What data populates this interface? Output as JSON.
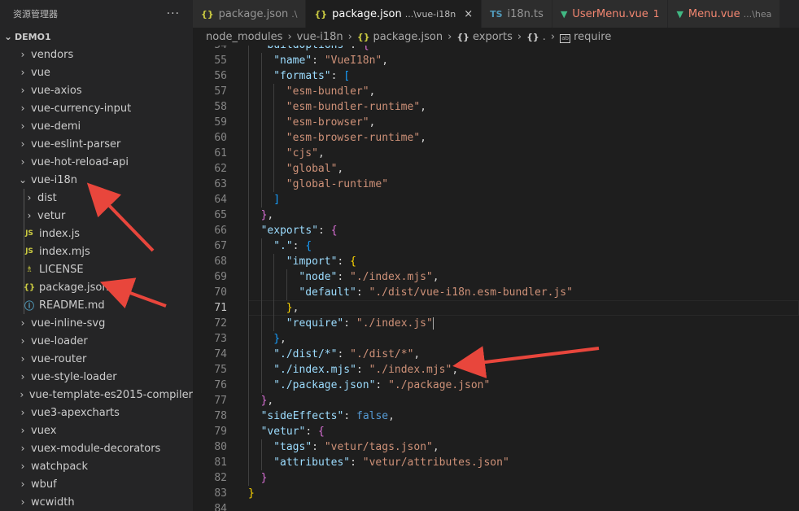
{
  "sidebar": {
    "title": "资源管理器",
    "more": "···",
    "project": "DEMO1",
    "items": [
      {
        "label": "vendors",
        "type": "folder",
        "depth": 1,
        "expanded": false
      },
      {
        "label": "vue",
        "type": "folder",
        "depth": 1,
        "expanded": false
      },
      {
        "label": "vue-axios",
        "type": "folder",
        "depth": 1,
        "expanded": false
      },
      {
        "label": "vue-currency-input",
        "type": "folder",
        "depth": 1,
        "expanded": false
      },
      {
        "label": "vue-demi",
        "type": "folder",
        "depth": 1,
        "expanded": false
      },
      {
        "label": "vue-eslint-parser",
        "type": "folder",
        "depth": 1,
        "expanded": false
      },
      {
        "label": "vue-hot-reload-api",
        "type": "folder",
        "depth": 1,
        "expanded": false
      },
      {
        "label": "vue-i18n",
        "type": "folder",
        "depth": 1,
        "expanded": true
      },
      {
        "label": "dist",
        "type": "folder",
        "depth": 2,
        "expanded": false
      },
      {
        "label": "vetur",
        "type": "folder",
        "depth": 2,
        "expanded": false
      },
      {
        "label": "index.js",
        "type": "js",
        "depth": 2
      },
      {
        "label": "index.mjs",
        "type": "js",
        "depth": 2
      },
      {
        "label": "LICENSE",
        "type": "license",
        "depth": 2
      },
      {
        "label": "package.json",
        "type": "json",
        "depth": 2
      },
      {
        "label": "README.md",
        "type": "info",
        "depth": 2
      },
      {
        "label": "vue-inline-svg",
        "type": "folder",
        "depth": 1,
        "expanded": false
      },
      {
        "label": "vue-loader",
        "type": "folder",
        "depth": 1,
        "expanded": false
      },
      {
        "label": "vue-router",
        "type": "folder",
        "depth": 1,
        "expanded": false
      },
      {
        "label": "vue-style-loader",
        "type": "folder",
        "depth": 1,
        "expanded": false
      },
      {
        "label": "vue-template-es2015-compiler",
        "type": "folder",
        "depth": 1,
        "expanded": false
      },
      {
        "label": "vue3-apexcharts",
        "type": "folder",
        "depth": 1,
        "expanded": false
      },
      {
        "label": "vuex",
        "type": "folder",
        "depth": 1,
        "expanded": false
      },
      {
        "label": "vuex-module-decorators",
        "type": "folder",
        "depth": 1,
        "expanded": false
      },
      {
        "label": "watchpack",
        "type": "folder",
        "depth": 1,
        "expanded": false
      },
      {
        "label": "wbuf",
        "type": "folder",
        "depth": 1,
        "expanded": false
      },
      {
        "label": "wcwidth",
        "type": "folder",
        "depth": 1,
        "expanded": false
      }
    ]
  },
  "tabs": [
    {
      "icon": "{}",
      "icon_type": "json",
      "label": "package.json",
      "desc": ".\\",
      "active": false
    },
    {
      "icon": "{}",
      "icon_type": "json",
      "label": "package.json",
      "desc": "...\\vue-i18n",
      "active": true,
      "close": "×"
    },
    {
      "icon": "TS",
      "icon_type": "ts",
      "label": "i18n.ts",
      "desc": "",
      "active": false
    },
    {
      "icon": "V",
      "icon_type": "vue",
      "label": "UserMenu.vue",
      "desc": "",
      "active": false,
      "error": true,
      "error_count": "1"
    },
    {
      "icon": "V",
      "icon_type": "vue",
      "label": "Menu.vue",
      "desc": "...\\hea",
      "active": false,
      "error": true
    }
  ],
  "breadcrumb": {
    "parts": [
      "node_modules",
      "vue-i18n",
      "package.json",
      "exports",
      ".",
      "require"
    ],
    "icons": [
      "",
      "",
      "{}",
      "{}",
      "{}",
      "abc"
    ]
  },
  "editor": {
    "current_line": 71,
    "lines": [
      {
        "n": "54",
        "indent": 1,
        "tokens": [
          [
            "k",
            "\"buildOptions\""
          ],
          [
            "p",
            ": "
          ],
          [
            "b2",
            "{"
          ]
        ]
      },
      {
        "n": "55",
        "indent": 2,
        "tokens": [
          [
            "k",
            "\"name\""
          ],
          [
            "p",
            ": "
          ],
          [
            "s",
            "\"VueI18n\""
          ],
          [
            "p",
            ","
          ]
        ]
      },
      {
        "n": "56",
        "indent": 2,
        "tokens": [
          [
            "k",
            "\"formats\""
          ],
          [
            "p",
            ": "
          ],
          [
            "b3",
            "["
          ]
        ]
      },
      {
        "n": "57",
        "indent": 3,
        "tokens": [
          [
            "s",
            "\"esm-bundler\""
          ],
          [
            "p",
            ","
          ]
        ]
      },
      {
        "n": "58",
        "indent": 3,
        "tokens": [
          [
            "s",
            "\"esm-bundler-runtime\""
          ],
          [
            "p",
            ","
          ]
        ]
      },
      {
        "n": "59",
        "indent": 3,
        "tokens": [
          [
            "s",
            "\"esm-browser\""
          ],
          [
            "p",
            ","
          ]
        ]
      },
      {
        "n": "60",
        "indent": 3,
        "tokens": [
          [
            "s",
            "\"esm-browser-runtime\""
          ],
          [
            "p",
            ","
          ]
        ]
      },
      {
        "n": "61",
        "indent": 3,
        "tokens": [
          [
            "s",
            "\"cjs\""
          ],
          [
            "p",
            ","
          ]
        ]
      },
      {
        "n": "62",
        "indent": 3,
        "tokens": [
          [
            "s",
            "\"global\""
          ],
          [
            "p",
            ","
          ]
        ]
      },
      {
        "n": "63",
        "indent": 3,
        "tokens": [
          [
            "s",
            "\"global-runtime\""
          ]
        ]
      },
      {
        "n": "64",
        "indent": 2,
        "tokens": [
          [
            "b3",
            "]"
          ]
        ]
      },
      {
        "n": "65",
        "indent": 1,
        "tokens": [
          [
            "b2",
            "}"
          ],
          [
            "p",
            ","
          ]
        ]
      },
      {
        "n": "66",
        "indent": 1,
        "tokens": [
          [
            "k",
            "\"exports\""
          ],
          [
            "p",
            ": "
          ],
          [
            "b2",
            "{"
          ]
        ]
      },
      {
        "n": "67",
        "indent": 2,
        "tokens": [
          [
            "k",
            "\".\""
          ],
          [
            "p",
            ": "
          ],
          [
            "b3",
            "{"
          ]
        ]
      },
      {
        "n": "68",
        "indent": 3,
        "tokens": [
          [
            "k",
            "\"import\""
          ],
          [
            "p",
            ": "
          ],
          [
            "b1",
            "{"
          ]
        ]
      },
      {
        "n": "69",
        "indent": 4,
        "tokens": [
          [
            "k",
            "\"node\""
          ],
          [
            "p",
            ": "
          ],
          [
            "s",
            "\"./index.mjs\""
          ],
          [
            "p",
            ","
          ]
        ]
      },
      {
        "n": "70",
        "indent": 4,
        "tokens": [
          [
            "k",
            "\"default\""
          ],
          [
            "p",
            ": "
          ],
          [
            "s",
            "\"./dist/vue-i18n.esm-bundler.js\""
          ]
        ]
      },
      {
        "n": "71",
        "indent": 3,
        "tokens": [
          [
            "b1",
            "}"
          ],
          [
            "p",
            ","
          ]
        ]
      },
      {
        "n": "72",
        "indent": 3,
        "tokens": [
          [
            "k",
            "\"require\""
          ],
          [
            "p",
            ": "
          ],
          [
            "s",
            "\"./index.js\""
          ]
        ],
        "caret": true
      },
      {
        "n": "73",
        "indent": 2,
        "tokens": [
          [
            "b3",
            "}"
          ],
          [
            "p",
            ","
          ]
        ]
      },
      {
        "n": "74",
        "indent": 2,
        "tokens": [
          [
            "k",
            "\"./dist/*\""
          ],
          [
            "p",
            ": "
          ],
          [
            "s",
            "\"./dist/*\""
          ],
          [
            "p",
            ","
          ]
        ]
      },
      {
        "n": "75",
        "indent": 2,
        "tokens": [
          [
            "k",
            "\"./index.mjs\""
          ],
          [
            "p",
            ": "
          ],
          [
            "s",
            "\"./index.mjs\""
          ],
          [
            "p",
            ","
          ]
        ]
      },
      {
        "n": "76",
        "indent": 2,
        "tokens": [
          [
            "k",
            "\"./package.json\""
          ],
          [
            "p",
            ": "
          ],
          [
            "s",
            "\"./package.json\""
          ]
        ]
      },
      {
        "n": "77",
        "indent": 1,
        "tokens": [
          [
            "b2",
            "}"
          ],
          [
            "p",
            ","
          ]
        ]
      },
      {
        "n": "78",
        "indent": 1,
        "tokens": [
          [
            "k",
            "\"sideEffects\""
          ],
          [
            "p",
            ": "
          ],
          [
            "kw",
            "false"
          ],
          [
            "p",
            ","
          ]
        ]
      },
      {
        "n": "79",
        "indent": 1,
        "tokens": [
          [
            "k",
            "\"vetur\""
          ],
          [
            "p",
            ": "
          ],
          [
            "b2",
            "{"
          ]
        ]
      },
      {
        "n": "80",
        "indent": 2,
        "tokens": [
          [
            "k",
            "\"tags\""
          ],
          [
            "p",
            ": "
          ],
          [
            "s",
            "\"vetur/tags.json\""
          ],
          [
            "p",
            ","
          ]
        ]
      },
      {
        "n": "81",
        "indent": 2,
        "tokens": [
          [
            "k",
            "\"attributes\""
          ],
          [
            "p",
            ": "
          ],
          [
            "s",
            "\"vetur/attributes.json\""
          ]
        ]
      },
      {
        "n": "82",
        "indent": 1,
        "tokens": [
          [
            "b2",
            "}"
          ]
        ]
      },
      {
        "n": "83",
        "indent": 0,
        "tokens": [
          [
            "b1",
            "}"
          ]
        ]
      },
      {
        "n": "84",
        "indent": 0,
        "tokens": []
      }
    ]
  },
  "colors": {
    "arrow": "#e8463c",
    "sidebar_bg": "#252526",
    "editor_bg": "#1e1e1e"
  }
}
